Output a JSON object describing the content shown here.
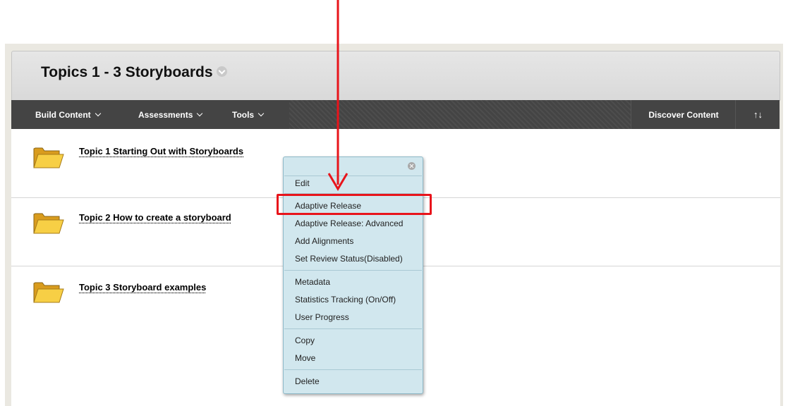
{
  "page": {
    "title": "Topics 1 - 3 Storyboards"
  },
  "toolbar": {
    "build_content": "Build Content",
    "assessments": "Assessments",
    "tools": "Tools",
    "discover_content": "Discover Content",
    "sort_icon": "↑↓"
  },
  "items": [
    {
      "title": "Topic 1 Starting Out with Storyboards",
      "icon": "folder-icon"
    },
    {
      "title": "Topic 2 How to create a storyboard",
      "icon": "folder-icon"
    },
    {
      "title": "Topic 3 Storyboard examples",
      "icon": "folder-icon"
    }
  ],
  "context_menu": {
    "edit": "Edit",
    "adaptive_release": "Adaptive Release",
    "adaptive_release_advanced": "Adaptive Release: Advanced",
    "add_alignments": "Add Alignments",
    "set_review_status": "Set Review Status(Disabled)",
    "metadata": "Metadata",
    "statistics_tracking": "Statistics Tracking (On/Off)",
    "user_progress": "User Progress",
    "copy": "Copy",
    "move": "Move",
    "delete": "Delete"
  },
  "annotation": {
    "color": "#e8141b",
    "highlighted_item": "Adaptive Release"
  }
}
